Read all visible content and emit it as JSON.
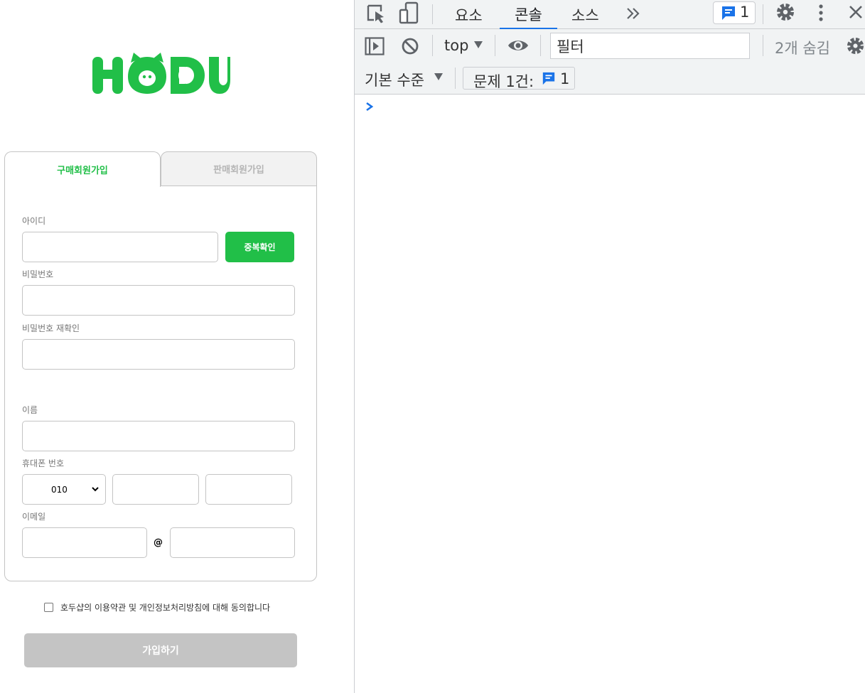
{
  "page": {
    "logo_text": "HODU",
    "tabs": {
      "buyer": "구매회원가입",
      "seller": "판매회원가입"
    },
    "fields": {
      "id_label": "아이디",
      "dup_check": "중복확인",
      "password_label": "비밀번호",
      "password_confirm_label": "비밀번호 재확인",
      "name_label": "이름",
      "phone_label": "휴대폰 번호",
      "phone_prefix": "010",
      "email_label": "이메일",
      "email_at": "@"
    },
    "agree_text": "호두샵의 이용약관 및 개인정보처리방침에 대해 동의합니다",
    "join_button": "가입하기"
  },
  "devtools": {
    "tabs": [
      "요소",
      "콘솔",
      "소스"
    ],
    "active_tab": "콘솔",
    "issues_badge_count": "1",
    "context": "top",
    "filter_placeholder": "필터",
    "hidden_count": "2개 숨김",
    "level": "기본 수준",
    "issues_label": "문제 1건:",
    "issues_count": "1"
  },
  "colors": {
    "brand_green": "#21bf48",
    "disabled_gray": "#c4c4c4",
    "devtools_blue": "#1a73e8"
  }
}
